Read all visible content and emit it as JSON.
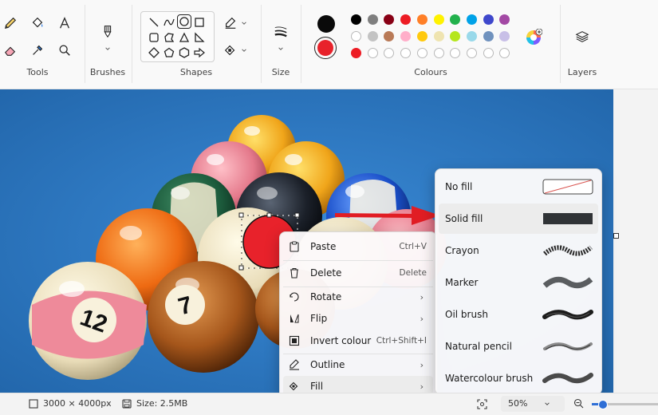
{
  "toolbar": {
    "groups": {
      "tools": "Tools",
      "brushes": "Brushes",
      "shapes": "Shapes",
      "size": "Size",
      "colours": "Colours",
      "layers": "Layers"
    },
    "primary_color": "#0a0a0a",
    "secondary_color": "#e8222b",
    "palette_row1": [
      "#000000",
      "#7f7f7f",
      "#880015",
      "#ed1c24",
      "#ff7f27",
      "#fff200",
      "#22b14c",
      "#00a2e8",
      "#3f48cc",
      "#a349a4"
    ],
    "palette_row2": [
      "#ffffff",
      "#c3c3c3",
      "#b97a57",
      "#ffaec9",
      "#ffc90e",
      "#efe4b0",
      "#b5e61d",
      "#99d9ea",
      "#7092be",
      "#c8bfe7"
    ],
    "palette_row3_first": "#ed1c24"
  },
  "context_menu": {
    "items": [
      {
        "label": "Paste",
        "shortcut": "Ctrl+V",
        "icon": "paste-icon"
      },
      {
        "label": "Delete",
        "shortcut": "Delete",
        "icon": "trash-icon"
      },
      {
        "label": "Rotate",
        "arrow": "›",
        "icon": "rotate-icon"
      },
      {
        "label": "Flip",
        "arrow": "›",
        "icon": "flip-icon"
      },
      {
        "label": "Invert colour",
        "shortcut": "Ctrl+Shift+I",
        "icon": "invert-icon"
      },
      {
        "label": "Outline",
        "arrow": "›",
        "icon": "outline-icon"
      },
      {
        "label": "Fill",
        "arrow": "›",
        "icon": "fill-icon"
      }
    ]
  },
  "fill_menu": {
    "items": [
      {
        "label": "No fill"
      },
      {
        "label": "Solid fill"
      },
      {
        "label": "Crayon"
      },
      {
        "label": "Marker"
      },
      {
        "label": "Oil brush"
      },
      {
        "label": "Natural pencil"
      },
      {
        "label": "Watercolour brush"
      }
    ]
  },
  "status": {
    "dimensions": "3000 × 4000px",
    "size": "Size: 2.5MB",
    "zoom": "50%"
  },
  "canvas": {
    "balls": [
      {
        "number": "12"
      },
      {
        "number": "7"
      }
    ]
  }
}
